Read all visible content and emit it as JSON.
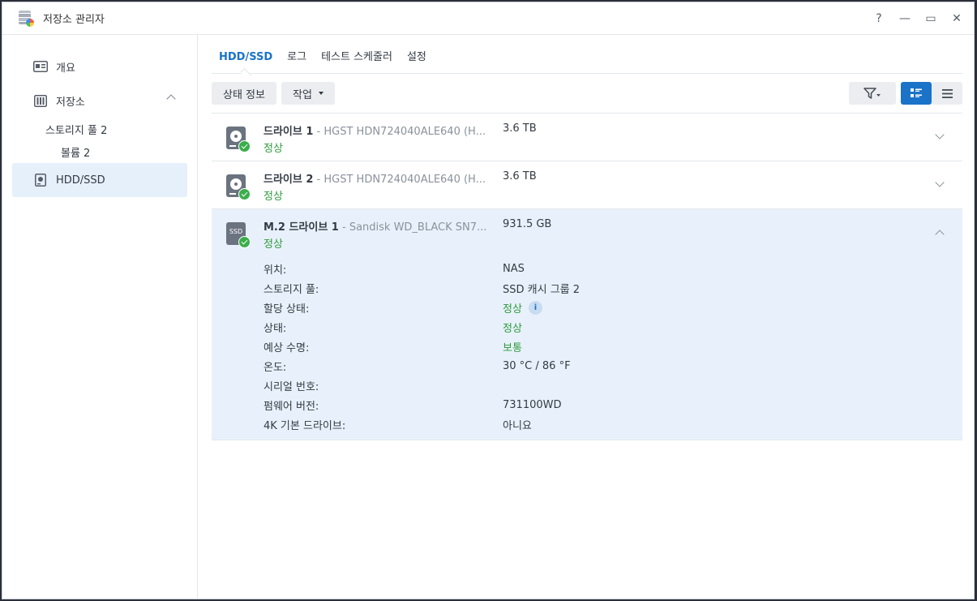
{
  "window": {
    "title": "저장소 관리자"
  },
  "controls": {
    "help": "?",
    "minimize": "—",
    "maximize": "▭",
    "close": "✕"
  },
  "sidebar": {
    "overview": "개요",
    "storage": "저장소",
    "pool": "스토리지 풀 2",
    "volume": "볼륨 2",
    "hddssd": "HDD/SSD"
  },
  "tabs": [
    {
      "label": "HDD/SSD",
      "active": true
    },
    {
      "label": "로그"
    },
    {
      "label": "테스트 스케줄러"
    },
    {
      "label": "설정"
    }
  ],
  "toolbar": {
    "status_info": "상태 정보",
    "action": "작업"
  },
  "drives": [
    {
      "name": "드라이브 1",
      "model": " - HGST HDN724040ALE640 (H...",
      "size": "3.6 TB",
      "status": "정상",
      "kind": "hdd"
    },
    {
      "name": "드라이브 2",
      "model": " - HGST HDN724040ALE640 (H...",
      "size": "3.6 TB",
      "status": "정상",
      "kind": "hdd"
    },
    {
      "name": "M.2 드라이브 1",
      "model": " - Sandisk WD_BLACK SN7...",
      "size": "931.5 GB",
      "status": "정상",
      "kind": "ssd",
      "icon_text": "SSD"
    }
  ],
  "details": [
    {
      "label": "위치:",
      "value": "NAS"
    },
    {
      "label": "스토리지 풀:",
      "value": "SSD 캐시 그룹 2"
    },
    {
      "label": "할당 상태:",
      "value": "정상",
      "green": true,
      "info": "i"
    },
    {
      "label": "상태:",
      "value": "정상",
      "green": true
    },
    {
      "label": "예상 수명:",
      "value": "보통",
      "green": true
    },
    {
      "label": "온도:",
      "value": "30 °C / 86 °F"
    },
    {
      "label": "시리얼 번호:",
      "value": ""
    },
    {
      "label": "펌웨어 버전:",
      "value": "731100WD"
    },
    {
      "label": "4K 기본 드라이브:",
      "value": "아니요"
    }
  ],
  "colors": {
    "accent": "#1a73c8",
    "ok": "#2e9a3c",
    "selected_bg": "#e8f1fb"
  }
}
